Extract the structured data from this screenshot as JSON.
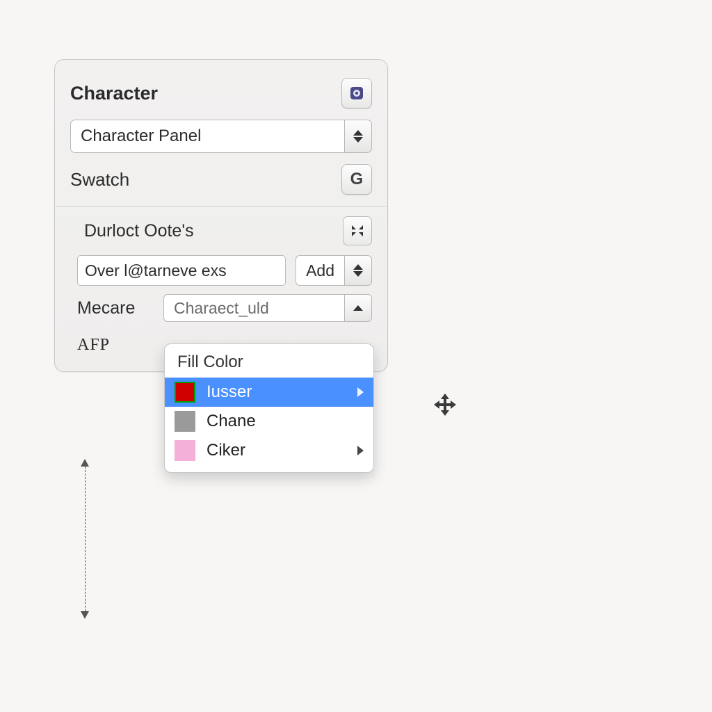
{
  "panel": {
    "title": "Character",
    "select_value": "Character Panel",
    "swatch_label": "Swatch",
    "section2_label": "Durloct Oote's",
    "over_value": "Over l@tarneve exs",
    "add_label": "Add",
    "mecare_label": "Mecare",
    "mecare_select": "Charaect_uld",
    "atp_label": "AFP"
  },
  "popup": {
    "title": "Fill Color",
    "items": [
      {
        "label": "Iusser",
        "selected": true,
        "has_sub": true,
        "swatch": "red"
      },
      {
        "label": "Chane",
        "selected": false,
        "has_sub": false,
        "swatch": "gray"
      },
      {
        "label": "Ciker",
        "selected": false,
        "has_sub": true,
        "swatch": "pink"
      }
    ]
  },
  "icons": {
    "panel_menu": "camera-icon",
    "swatch_btn": "G",
    "close_x": "✕"
  }
}
